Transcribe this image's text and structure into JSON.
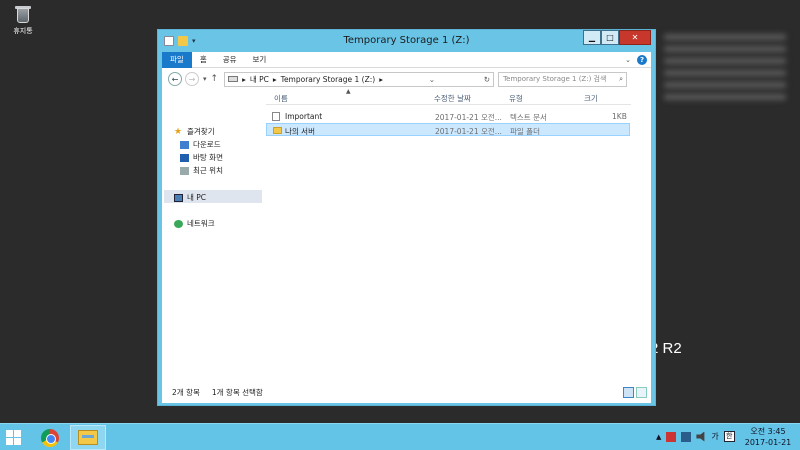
{
  "desktop": {
    "recycle_bin_label": "휴지통",
    "server_text": "2 R2"
  },
  "window": {
    "title": "Temporary Storage 1 (Z:)",
    "ribbon_tabs": [
      "파일",
      "홈",
      "공유",
      "보기"
    ],
    "address": {
      "segments": [
        "내 PC",
        "Temporary Storage 1 (Z:)"
      ]
    },
    "search": {
      "placeholder": "Temporary Storage 1 (Z:) 검색"
    },
    "nav_pane": {
      "favorites": "즐겨찾기",
      "downloads": "다운로드",
      "desktop": "바탕 화면",
      "recent": "최근 위치",
      "this_pc": "내 PC",
      "network": "네트워크"
    },
    "columns": [
      "이름",
      "수정한 날짜",
      "유형",
      "크기"
    ],
    "files": [
      {
        "name": "Important",
        "modified": "2017-01-21 오전...",
        "type": "텍스트 문서",
        "size": "1KB",
        "icon": "text-file-icon"
      },
      {
        "name": "나의 서버",
        "modified": "2017-01-21 오전...",
        "type": "파일 폴더",
        "size": "",
        "icon": "folder-icon"
      }
    ],
    "status": {
      "item_count": "2개 항목",
      "selection": "1개 항목 선택함"
    }
  },
  "taskbar": {
    "apps": [
      "chrome-icon",
      "file-explorer-icon"
    ],
    "tray_ime": "가",
    "tray_lang": "한",
    "clock": {
      "time": "오전 3:45",
      "date": "2017-01-21"
    }
  },
  "colors": {
    "window_frame": "#69c4e6",
    "taskbar": "#64c4e8",
    "file_tab": "#1979ca",
    "close_button": "#c7372b",
    "selection": "#cce8ff"
  }
}
